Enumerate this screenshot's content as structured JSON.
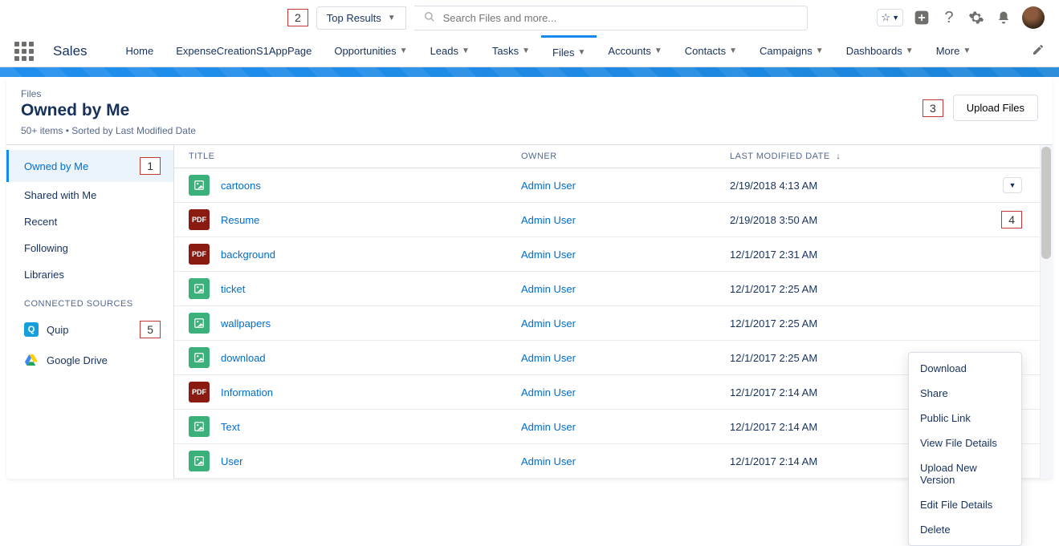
{
  "topbar": {
    "callout_2": "2",
    "search_scope": "Top Results",
    "search_placeholder": "Search Files and more..."
  },
  "nav": {
    "app_name": "Sales",
    "items": [
      "Home",
      "ExpenseCreationS1AppPage",
      "Opportunities",
      "Leads",
      "Tasks",
      "Files",
      "Accounts",
      "Contacts",
      "Campaigns",
      "Dashboards",
      "More"
    ],
    "active": "Files"
  },
  "page": {
    "breadcrumb": "Files",
    "title": "Owned by Me",
    "meta": "50+ items • Sorted by Last Modified Date",
    "upload_label": "Upload Files",
    "callout_3": "3"
  },
  "sidebar": {
    "views": [
      "Owned by Me",
      "Shared with Me",
      "Recent",
      "Following",
      "Libraries"
    ],
    "callout_1": "1",
    "connected_heading": "CONNECTED SOURCES",
    "connected": [
      "Quip",
      "Google Drive"
    ],
    "callout_5": "5"
  },
  "table": {
    "headers": {
      "title": "TITLE",
      "owner": "OWNER",
      "date": "LAST MODIFIED DATE"
    },
    "callout_4": "4",
    "rows": [
      {
        "icon": "img",
        "title": "cartoons",
        "owner": "Admin User",
        "date": "2/19/2018 4:13 AM",
        "menu": true
      },
      {
        "icon": "pdf",
        "title": "Resume",
        "owner": "Admin User",
        "date": "2/19/2018 3:50 AM",
        "callout": true
      },
      {
        "icon": "pdf",
        "title": "background",
        "owner": "Admin User",
        "date": "12/1/2017 2:31 AM"
      },
      {
        "icon": "img",
        "title": "ticket",
        "owner": "Admin User",
        "date": "12/1/2017 2:25 AM"
      },
      {
        "icon": "img",
        "title": "wallpapers",
        "owner": "Admin User",
        "date": "12/1/2017 2:25 AM"
      },
      {
        "icon": "img",
        "title": "download",
        "owner": "Admin User",
        "date": "12/1/2017 2:25 AM"
      },
      {
        "icon": "pdf",
        "title": "Information",
        "owner": "Admin User",
        "date": "12/1/2017 2:14 AM"
      },
      {
        "icon": "img",
        "title": "Text",
        "owner": "Admin User",
        "date": "12/1/2017 2:14 AM",
        "menu": true
      },
      {
        "icon": "img",
        "title": "User",
        "owner": "Admin User",
        "date": "12/1/2017 2:14 AM",
        "menu": true
      }
    ]
  },
  "menu": {
    "items": [
      "Download",
      "Share",
      "Public Link",
      "View File Details",
      "Upload New Version",
      "Edit File Details",
      "Delete"
    ]
  }
}
